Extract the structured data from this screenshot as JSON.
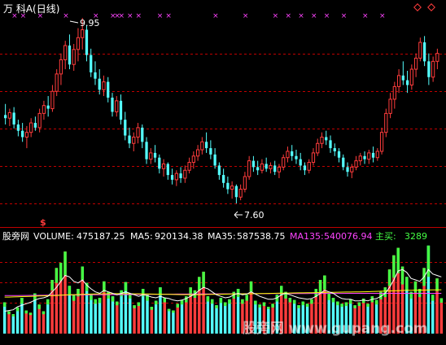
{
  "title": "万 科A(日线)",
  "watermark": "股旁网 www.gupang.com",
  "colors": {
    "background": "#000000",
    "up": "#ff3c3c",
    "down": "#54ffff",
    "grid": "#c00000",
    "ma5": "#ffffff",
    "ma35": "#ffff00",
    "ma135": "#ff44ff",
    "mainbuy": "#44ff44",
    "marker": "#ff44ff"
  },
  "chart_data": [
    {
      "type": "candlestick",
      "title": "万 科A(日线)",
      "high_label": "9.95",
      "low_label": "7.60",
      "marker_icons": [
        "diamond-icon",
        "diamond-icon"
      ],
      "candles": [
        [
          8.72,
          8.86,
          8.6,
          8.68
        ],
        [
          8.68,
          8.8,
          8.58,
          8.75
        ],
        [
          8.75,
          8.82,
          8.55,
          8.6
        ],
        [
          8.6,
          8.66,
          8.45,
          8.52
        ],
        [
          8.52,
          8.62,
          8.38,
          8.44
        ],
        [
          8.44,
          8.58,
          8.3,
          8.5
        ],
        [
          8.5,
          8.68,
          8.44,
          8.62
        ],
        [
          8.62,
          8.7,
          8.52,
          8.56
        ],
        [
          8.56,
          8.8,
          8.5,
          8.74
        ],
        [
          8.74,
          8.9,
          8.66,
          8.84
        ],
        [
          8.84,
          8.96,
          8.7,
          8.8
        ],
        [
          8.8,
          9.1,
          8.76,
          9.02
        ],
        [
          9.02,
          9.3,
          8.96,
          9.24
        ],
        [
          9.24,
          9.5,
          9.1,
          9.42
        ],
        [
          9.42,
          9.66,
          9.3,
          9.6
        ],
        [
          9.6,
          9.74,
          9.3,
          9.36
        ],
        [
          9.36,
          9.62,
          9.28,
          9.55
        ],
        [
          9.55,
          9.82,
          9.4,
          9.7
        ],
        [
          9.7,
          9.95,
          9.55,
          9.8
        ],
        [
          9.8,
          9.86,
          9.4,
          9.48
        ],
        [
          9.48,
          9.56,
          9.2,
          9.26
        ],
        [
          9.26,
          9.4,
          9.1,
          9.18
        ],
        [
          9.18,
          9.3,
          8.98,
          9.04
        ],
        [
          9.04,
          9.22,
          8.96,
          9.14
        ],
        [
          9.14,
          9.2,
          8.88,
          8.94
        ],
        [
          8.94,
          9.0,
          8.7,
          8.76
        ],
        [
          8.76,
          8.96,
          8.7,
          8.9
        ],
        [
          8.9,
          8.98,
          8.6,
          8.66
        ],
        [
          8.66,
          8.76,
          8.4,
          8.46
        ],
        [
          8.46,
          8.56,
          8.3,
          8.36
        ],
        [
          8.36,
          8.5,
          8.26,
          8.44
        ],
        [
          8.44,
          8.62,
          8.36,
          8.56
        ],
        [
          8.56,
          8.6,
          8.3,
          8.38
        ],
        [
          8.38,
          8.44,
          8.1,
          8.16
        ],
        [
          8.16,
          8.3,
          8.1,
          8.24
        ],
        [
          8.24,
          8.34,
          8.12,
          8.18
        ],
        [
          8.18,
          8.22,
          7.98,
          8.04
        ],
        [
          8.04,
          8.16,
          7.94,
          8.1
        ],
        [
          8.1,
          8.12,
          7.9,
          7.96
        ],
        [
          7.96,
          8.04,
          7.84,
          7.9
        ],
        [
          7.9,
          8.02,
          7.82,
          7.98
        ],
        [
          7.98,
          8.06,
          7.86,
          7.92
        ],
        [
          7.92,
          8.08,
          7.86,
          8.02
        ],
        [
          8.02,
          8.18,
          7.98,
          8.12
        ],
        [
          8.12,
          8.26,
          8.04,
          8.2
        ],
        [
          8.2,
          8.34,
          8.14,
          8.28
        ],
        [
          8.28,
          8.44,
          8.22,
          8.38
        ],
        [
          8.38,
          8.5,
          8.24,
          8.3
        ],
        [
          8.3,
          8.4,
          8.16,
          8.22
        ],
        [
          8.22,
          8.3,
          8.04,
          8.08
        ],
        [
          8.08,
          8.12,
          7.9,
          7.96
        ],
        [
          7.96,
          8.04,
          7.8,
          7.86
        ],
        [
          7.86,
          7.94,
          7.72,
          7.78
        ],
        [
          7.78,
          7.88,
          7.66,
          7.82
        ],
        [
          7.82,
          7.84,
          7.6,
          7.68
        ],
        [
          7.68,
          7.84,
          7.64,
          7.78
        ],
        [
          7.78,
          8.0,
          7.74,
          7.94
        ],
        [
          7.94,
          8.2,
          7.9,
          8.14
        ],
        [
          8.14,
          8.2,
          8.0,
          8.06
        ],
        [
          8.06,
          8.14,
          7.96,
          8.02
        ],
        [
          8.02,
          8.16,
          7.98,
          8.1
        ],
        [
          8.1,
          8.18,
          8.0,
          8.04
        ],
        [
          8.04,
          8.12,
          7.98,
          8.08
        ],
        [
          8.08,
          8.14,
          7.96,
          8.0
        ],
        [
          8.0,
          8.1,
          7.92,
          8.06
        ],
        [
          8.06,
          8.22,
          8.02,
          8.18
        ],
        [
          8.18,
          8.32,
          8.12,
          8.26
        ],
        [
          8.26,
          8.34,
          8.14,
          8.2
        ],
        [
          8.2,
          8.28,
          8.1,
          8.16
        ],
        [
          8.16,
          8.24,
          8.02,
          8.08
        ],
        [
          8.08,
          8.12,
          7.96,
          8.02
        ],
        [
          8.02,
          8.16,
          7.98,
          8.12
        ],
        [
          8.12,
          8.3,
          8.08,
          8.24
        ],
        [
          8.24,
          8.42,
          8.2,
          8.36
        ],
        [
          8.36,
          8.5,
          8.3,
          8.44
        ],
        [
          8.44,
          8.52,
          8.34,
          8.4
        ],
        [
          8.4,
          8.46,
          8.24,
          8.3
        ],
        [
          8.3,
          8.36,
          8.2,
          8.26
        ],
        [
          8.26,
          8.3,
          8.12,
          8.18
        ],
        [
          8.18,
          8.22,
          8.02,
          8.06
        ],
        [
          8.06,
          8.12,
          7.94,
          8.0
        ],
        [
          8.0,
          8.1,
          7.92,
          8.06
        ],
        [
          8.06,
          8.2,
          8.02,
          8.14
        ],
        [
          8.14,
          8.24,
          8.08,
          8.2
        ],
        [
          8.2,
          8.26,
          8.1,
          8.16
        ],
        [
          8.16,
          8.28,
          8.1,
          8.24
        ],
        [
          8.24,
          8.32,
          8.12,
          8.18
        ],
        [
          8.18,
          8.3,
          8.14,
          8.26
        ],
        [
          8.26,
          8.56,
          8.22,
          8.5
        ],
        [
          8.5,
          8.8,
          8.44,
          8.74
        ],
        [
          8.74,
          9.0,
          8.68,
          8.92
        ],
        [
          8.92,
          9.14,
          8.8,
          9.08
        ],
        [
          9.08,
          9.3,
          9.0,
          9.22
        ],
        [
          9.22,
          9.4,
          9.1,
          9.16
        ],
        [
          9.16,
          9.28,
          9.0,
          9.1
        ],
        [
          9.1,
          9.36,
          9.04,
          9.3
        ],
        [
          9.3,
          9.5,
          9.2,
          9.44
        ],
        [
          9.44,
          9.7,
          9.4,
          9.64
        ],
        [
          9.64,
          9.72,
          9.34,
          9.4
        ],
        [
          9.4,
          9.5,
          9.1,
          9.2
        ],
        [
          9.2,
          9.46,
          9.14,
          9.4
        ],
        [
          9.4,
          9.56,
          9.3,
          9.5
        ]
      ]
    },
    {
      "type": "bar",
      "indicator_label": "股旁网",
      "volume_label": "VOLUME:",
      "volume_value": "475187.25",
      "ma5_label": "MA5:",
      "ma5_value": "920134.38",
      "ma35_label": "MA35:",
      "ma35_value": "587538.75",
      "ma135_label": "MA135:",
      "ma135_value": "540076.94",
      "mainbuy_label": "主买:",
      "mainbuy_value": "3289",
      "signal_marker": "$",
      "vmax": 1200000,
      "volumes": [
        420000,
        300000,
        260000,
        350000,
        480000,
        310000,
        280000,
        540000,
        390000,
        300000,
        460000,
        720000,
        880000,
        950000,
        1100000,
        640000,
        520000,
        600000,
        900000,
        680000,
        520000,
        460000,
        480000,
        700000,
        560000,
        500000,
        430000,
        580000,
        690000,
        540000,
        380000,
        420000,
        600000,
        520000,
        360000,
        440000,
        620000,
        480000,
        330000,
        310000,
        400000,
        450000,
        500000,
        620000,
        580000,
        760000,
        830000,
        500000,
        460000,
        380000,
        480000,
        420000,
        460000,
        560000,
        600000,
        460000,
        520000,
        700000,
        440000,
        390000,
        420000,
        360000,
        400000,
        520000,
        640000,
        560000,
        480000,
        450000,
        380000,
        430000,
        400000,
        460000,
        600000,
        720000,
        780000,
        540000,
        480000,
        430000,
        400000,
        420000,
        460000,
        380000,
        420000,
        470000,
        400000,
        500000,
        450000,
        560000,
        620000,
        860000,
        1050000,
        1150000,
        900000,
        760000,
        560000,
        700000,
        600000,
        880000,
        1180000,
        520000,
        740000,
        475000
      ],
      "ma5": [
        300000,
        310000,
        320000,
        360000,
        380000,
        400000,
        420000,
        450000,
        470000,
        480000,
        500000,
        560000,
        620000,
        700000,
        780000,
        760000,
        700000,
        680000,
        720000,
        650000,
        600000,
        560000,
        540000,
        580000,
        560000,
        540000,
        520000,
        540000,
        560000,
        540000,
        520000,
        500000,
        520000,
        510000,
        490000,
        480000,
        500000,
        480000,
        470000,
        450000,
        440000,
        450000,
        470000,
        500000,
        530000,
        580000,
        620000,
        600000,
        560000,
        520000,
        500000,
        480000,
        490000,
        520000,
        540000,
        520000,
        530000,
        560000,
        530000,
        500000,
        480000,
        460000,
        460000,
        480000,
        520000,
        540000,
        520000,
        500000,
        480000,
        470000,
        460000,
        470000,
        500000,
        540000,
        580000,
        560000,
        540000,
        500000,
        470000,
        460000,
        460000,
        440000,
        440000,
        450000,
        440000,
        460000,
        470000,
        500000,
        540000,
        620000,
        720000,
        840000,
        860000,
        820000,
        740000,
        720000,
        700000,
        760000,
        860000,
        800000,
        780000,
        760000
      ],
      "ma35": [
        490000,
        490000,
        492000,
        494000,
        496000,
        498000,
        500000,
        502000,
        504000,
        506000,
        508000,
        510000,
        512000,
        515000,
        518000,
        520000,
        522000,
        524000,
        526000,
        528000,
        530000,
        532000,
        533000,
        534000,
        535000,
        536000,
        536000,
        536000,
        536000,
        535000,
        534000,
        533000,
        532000,
        531000,
        530000,
        529000,
        528000,
        527000,
        526000,
        525000,
        524000,
        523000,
        522000,
        522000,
        522000,
        523000,
        524000,
        525000,
        526000,
        527000,
        528000,
        529000,
        530000,
        531000,
        532000,
        533000,
        534000,
        535000,
        536000,
        537000,
        538000,
        539000,
        540000,
        541000,
        542000,
        543000,
        544000,
        545000,
        546000,
        547000,
        548000,
        549000,
        550000,
        551000,
        552000,
        553000,
        554000,
        555000,
        556000,
        557000,
        558000,
        559000,
        560000,
        561000,
        562000,
        564000,
        566000,
        568000,
        570000,
        572000,
        574000,
        576000,
        578000,
        580000,
        581000,
        582000,
        583000,
        584000,
        585000,
        586000,
        587000,
        587538
      ],
      "ma135": [
        510000,
        510000,
        511000,
        511000,
        512000,
        512000,
        513000,
        513000,
        514000,
        514000,
        515000,
        515000,
        516000,
        516000,
        517000,
        517000,
        518000,
        518000,
        519000,
        519000,
        520000,
        520000,
        521000,
        521000,
        522000,
        522000,
        523000,
        523000,
        524000,
        524000,
        525000,
        525000,
        526000,
        526000,
        527000,
        527000,
        528000,
        528000,
        529000,
        529000,
        530000,
        530000,
        530000,
        531000,
        531000,
        531000,
        532000,
        532000,
        532000,
        533000,
        533000,
        533000,
        534000,
        534000,
        534000,
        535000,
        535000,
        535000,
        536000,
        536000,
        536000,
        536000,
        537000,
        537000,
        537000,
        537000,
        538000,
        538000,
        538000,
        538000,
        538000,
        539000,
        539000,
        539000,
        539000,
        539000,
        539000,
        539000,
        539000,
        540000,
        540000,
        540000,
        540000,
        540000,
        540000,
        540000,
        540000,
        540000,
        540000,
        540000,
        540000,
        540000,
        540000,
        540000,
        540000,
        540000,
        540000,
        540000,
        540000,
        540000,
        540000,
        540077
      ],
      "mainbuy": [
        60000,
        40000,
        30000,
        50000,
        80000,
        40000,
        30000,
        90000,
        60000,
        40000,
        70000,
        140000,
        200000,
        240000,
        320000,
        120000,
        80000,
        100000,
        180000,
        110000,
        70000,
        60000,
        70000,
        140000,
        90000,
        70000,
        50000,
        80000,
        120000,
        70000,
        40000,
        50000,
        100000,
        80000,
        40000,
        50000,
        110000,
        60000,
        30000,
        30000,
        50000,
        60000,
        80000,
        120000,
        100000,
        180000,
        210000,
        70000,
        60000,
        40000,
        70000,
        50000,
        60000,
        90000,
        110000,
        60000,
        80000,
        150000,
        50000,
        40000,
        50000,
        30000,
        50000,
        90000,
        130000,
        90000,
        60000,
        50000,
        40000,
        50000,
        40000,
        60000,
        110000,
        160000,
        190000,
        90000,
        60000,
        50000,
        40000,
        50000,
        60000,
        40000,
        50000,
        60000,
        40000,
        80000,
        60000,
        100000,
        130000,
        220000,
        300000,
        340000,
        240000,
        170000,
        90000,
        150000,
        110000,
        240000,
        420000,
        80000,
        170000,
        60000
      ]
    }
  ]
}
